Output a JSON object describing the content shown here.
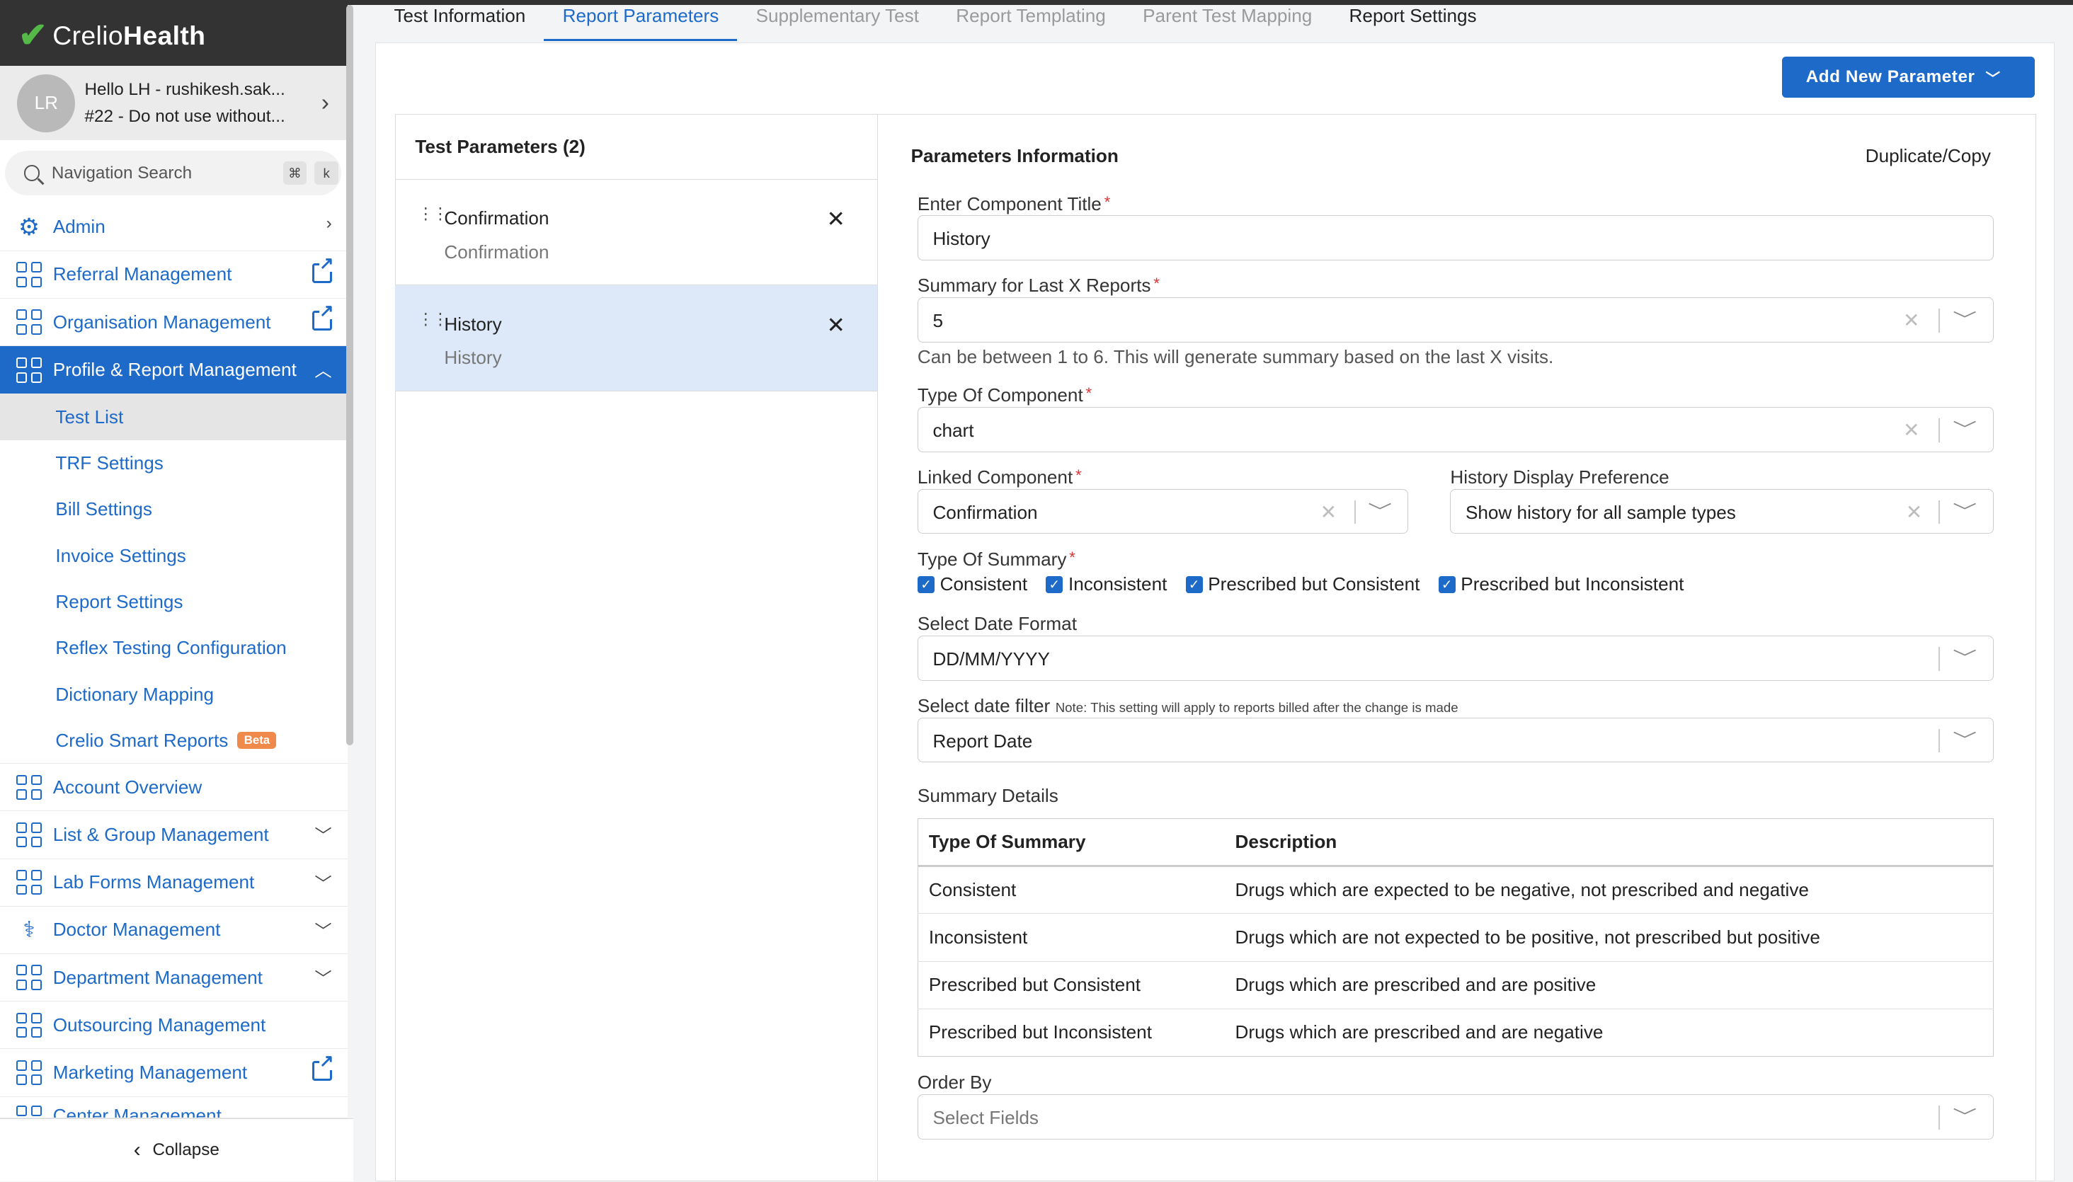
{
  "brand": {
    "name_part1": "Crelio",
    "name_part2": "Health"
  },
  "user": {
    "initials": "LR",
    "greeting": "Hello LH - rushikesh.sak...",
    "org": "#22 - Do not use without..."
  },
  "nav_search": {
    "placeholder": "Navigation Search",
    "kbd1": "⌘",
    "kbd2": "k"
  },
  "sidebar": {
    "items": [
      {
        "label": "Admin"
      },
      {
        "label": "Referral Management"
      },
      {
        "label": "Organisation Management"
      },
      {
        "label": "Profile & Report Management"
      },
      {
        "label": "Account Overview"
      },
      {
        "label": "List & Group Management"
      },
      {
        "label": "Lab Forms Management"
      },
      {
        "label": "Doctor Management"
      },
      {
        "label": "Department Management"
      },
      {
        "label": "Outsourcing Management"
      },
      {
        "label": "Marketing Management"
      },
      {
        "label": "Center Management"
      }
    ],
    "subitems": [
      {
        "label": "Test List"
      },
      {
        "label": "TRF Settings"
      },
      {
        "label": "Bill Settings"
      },
      {
        "label": "Invoice Settings"
      },
      {
        "label": "Report Settings"
      },
      {
        "label": "Reflex Testing Configuration"
      },
      {
        "label": "Dictionary Mapping"
      },
      {
        "label": "Crelio Smart Reports",
        "badge": "Beta"
      }
    ],
    "collapse_label": "Collapse"
  },
  "tabs": [
    {
      "label": "Test Information"
    },
    {
      "label": "Report Parameters"
    },
    {
      "label": "Supplementary Test"
    },
    {
      "label": "Report Templating"
    },
    {
      "label": "Parent Test Mapping"
    },
    {
      "label": "Report Settings"
    }
  ],
  "add_button": "Add New Parameter",
  "test_params": {
    "header": "Test Parameters (2)",
    "items": [
      {
        "title": "Confirmation",
        "subtitle": "Confirmation"
      },
      {
        "title": "History",
        "subtitle": "History"
      }
    ]
  },
  "form": {
    "title": "Parameters Information",
    "duplicate": "Duplicate/Copy",
    "component_title": {
      "label": "Enter Component Title",
      "value": "History"
    },
    "summary_last": {
      "label": "Summary for Last X Reports",
      "value": "5",
      "hint": "Can be between 1 to 6. This will generate summary based on the last X visits."
    },
    "component_type": {
      "label": "Type Of Component",
      "value": "chart"
    },
    "linked_component": {
      "label": "Linked Component",
      "value": "Confirmation"
    },
    "history_pref": {
      "label": "History Display Preference",
      "value": "Show history for all sample types"
    },
    "summary_type": {
      "label": "Type Of Summary",
      "options": [
        "Consistent",
        "Inconsistent",
        "Prescribed but Consistent",
        "Prescribed but Inconsistent"
      ]
    },
    "date_format": {
      "label": "Select Date Format",
      "value": "DD/MM/YYYY"
    },
    "date_filter": {
      "label": "Select date filter",
      "note": "Note: This setting will apply to reports billed after the change is made",
      "value": "Report Date"
    },
    "summary_details": {
      "label": "Summary Details",
      "headers": [
        "Type Of Summary",
        "Description"
      ],
      "rows": [
        [
          "Consistent",
          "Drugs which are expected to be negative, not prescribed and negative"
        ],
        [
          "Inconsistent",
          "Drugs which are not expected to be positive, not prescribed but positive"
        ],
        [
          "Prescribed but Consistent",
          "Drugs which are prescribed and are positive"
        ],
        [
          "Prescribed but Inconsistent",
          "Drugs which are prescribed and are negative"
        ]
      ]
    },
    "order_by": {
      "label": "Order By",
      "placeholder": "Select Fields"
    }
  }
}
